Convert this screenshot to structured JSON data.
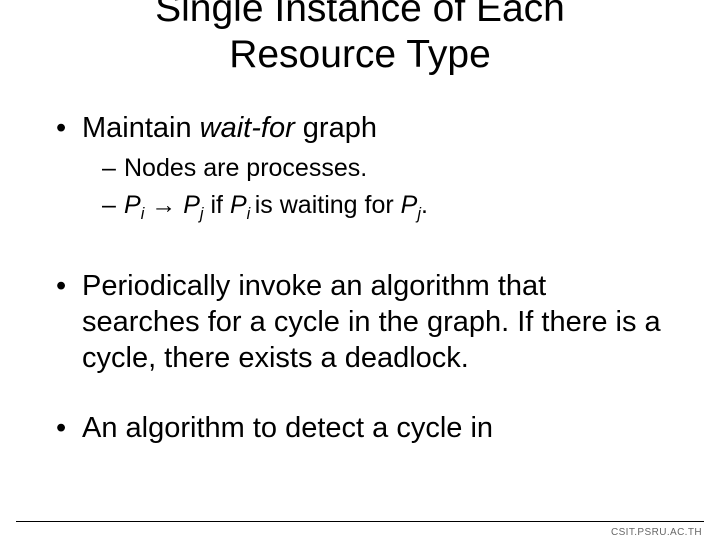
{
  "title_line1": "Single Instance of Each",
  "title_line2": "Resource Type",
  "bullets": {
    "b1": "Maintain ",
    "b1_em": "wait-for",
    "b1_tail": " graph",
    "b1_sub1": "Nodes are processes.",
    "b1_sub2_pi": "P",
    "b1_sub2_i": "i",
    "b1_sub2_arrow": " → ",
    "b1_sub2_pj": "P",
    "b1_sub2_j": "j",
    "b1_sub2_mid": "  if ",
    "b1_sub2_pi2": "P",
    "b1_sub2_i2": "i ",
    "b1_sub2_wait": "is waiting for ",
    "b1_sub2_pj2": "P",
    "b1_sub2_j2": "j",
    "b1_sub2_dot": ".",
    "b2": "Periodically invoke an algorithm that searches for a cycle in the graph. If there is a cycle, there exists a deadlock.",
    "b3": "An algorithm to detect a cycle in"
  },
  "footer": "CSIT.PSRU.AC.TH"
}
